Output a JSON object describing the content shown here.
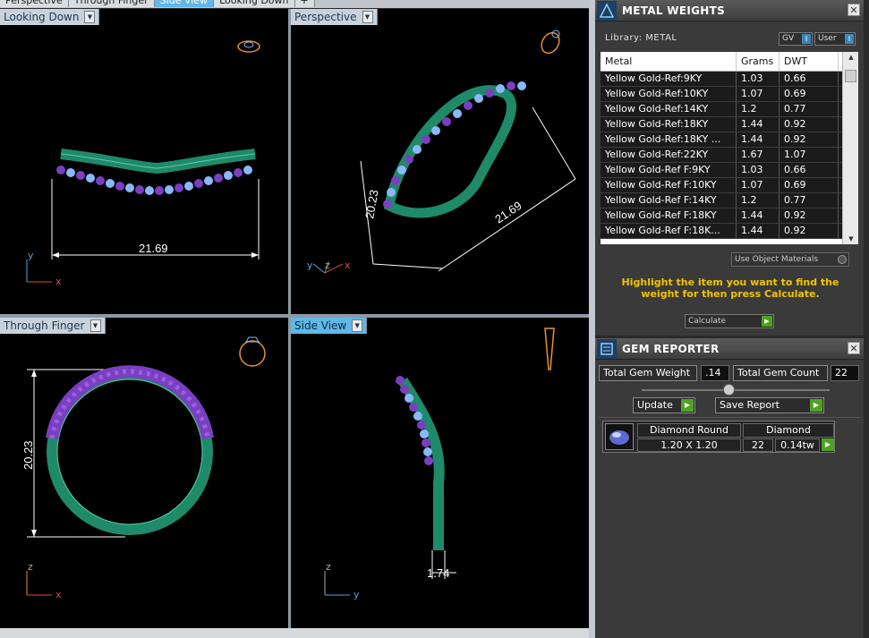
{
  "top_tabs": [
    {
      "label": "Perspective"
    },
    {
      "label": "Through Finger"
    },
    {
      "label": "Side View"
    },
    {
      "label": "Looking Down"
    },
    {
      "label": "+"
    }
  ],
  "viewports": {
    "top_left": {
      "label": "Looking Down",
      "dimension": "21.69",
      "axis_v": "y",
      "axis_h": "x"
    },
    "top_right": {
      "label": "Perspective",
      "dimension_long": "21.69",
      "dimension_short": "20.23",
      "axis_1": "y",
      "axis_2": "z",
      "axis_3": "x"
    },
    "bottom_left": {
      "label": "Through Finger",
      "dimension": "20.23",
      "axis_v": "z",
      "axis_h": "x"
    },
    "bottom_right": {
      "label": "Side View",
      "dimension": "1.74",
      "axis_v": "z",
      "axis_h": "y"
    }
  },
  "metal_weights": {
    "title": "METAL WEIGHTS",
    "library_label": "Library: METAL",
    "gv_label": "GV",
    "user_label": "User",
    "columns": [
      "Metal",
      "Grams",
      "DWT"
    ],
    "rows": [
      [
        "Yellow Gold-Ref:9KY",
        "1.03",
        "0.66"
      ],
      [
        "Yellow Gold-Ref:10KY",
        "1.07",
        "0.69"
      ],
      [
        "Yellow Gold-Ref:14KY",
        "1.2",
        "0.77"
      ],
      [
        "Yellow Gold-Ref:18KY",
        "1.44",
        "0.92"
      ],
      [
        "Yellow Gold-Ref:18KY ...",
        "1.44",
        "0.92"
      ],
      [
        "Yellow Gold-Ref:22KY",
        "1.67",
        "1.07"
      ],
      [
        "Yellow Gold-Ref F:9KY",
        "1.03",
        "0.66"
      ],
      [
        "Yellow Gold-Ref F:10KY",
        "1.07",
        "0.69"
      ],
      [
        "Yellow Gold-Ref F:14KY",
        "1.2",
        "0.77"
      ],
      [
        "Yellow Gold-Ref F:18KY",
        "1.44",
        "0.92"
      ],
      [
        "Yellow Gold-Ref F:18K...",
        "1.44",
        "0.92"
      ]
    ],
    "use_object_materials": "Use Object Materials",
    "hint": "Highlight the item you want to find the weight for then press Calculate.",
    "calculate_label": "Calculate"
  },
  "gem_reporter": {
    "title": "GEM REPORTER",
    "total_weight_label": "Total Gem Weight",
    "total_weight_value": ".14",
    "total_count_label": "Total Gem Count",
    "total_count_value": "22",
    "update_label": "Update",
    "save_report_label": "Save Report",
    "gem": {
      "shape": "Diamond Round",
      "material": "Diamond",
      "size": "1.20 X 1.20",
      "count": "22",
      "weight": "0.14tw"
    }
  },
  "colors": {
    "band": "#1e8a6a",
    "stones": "#7a3fc0",
    "stone_faces": "#8ab8ff",
    "axis_y": "#5aa0e0",
    "axis_x": "#e04a3a",
    "hint": "#f2c400",
    "active_tab": "#5fb8e8"
  }
}
